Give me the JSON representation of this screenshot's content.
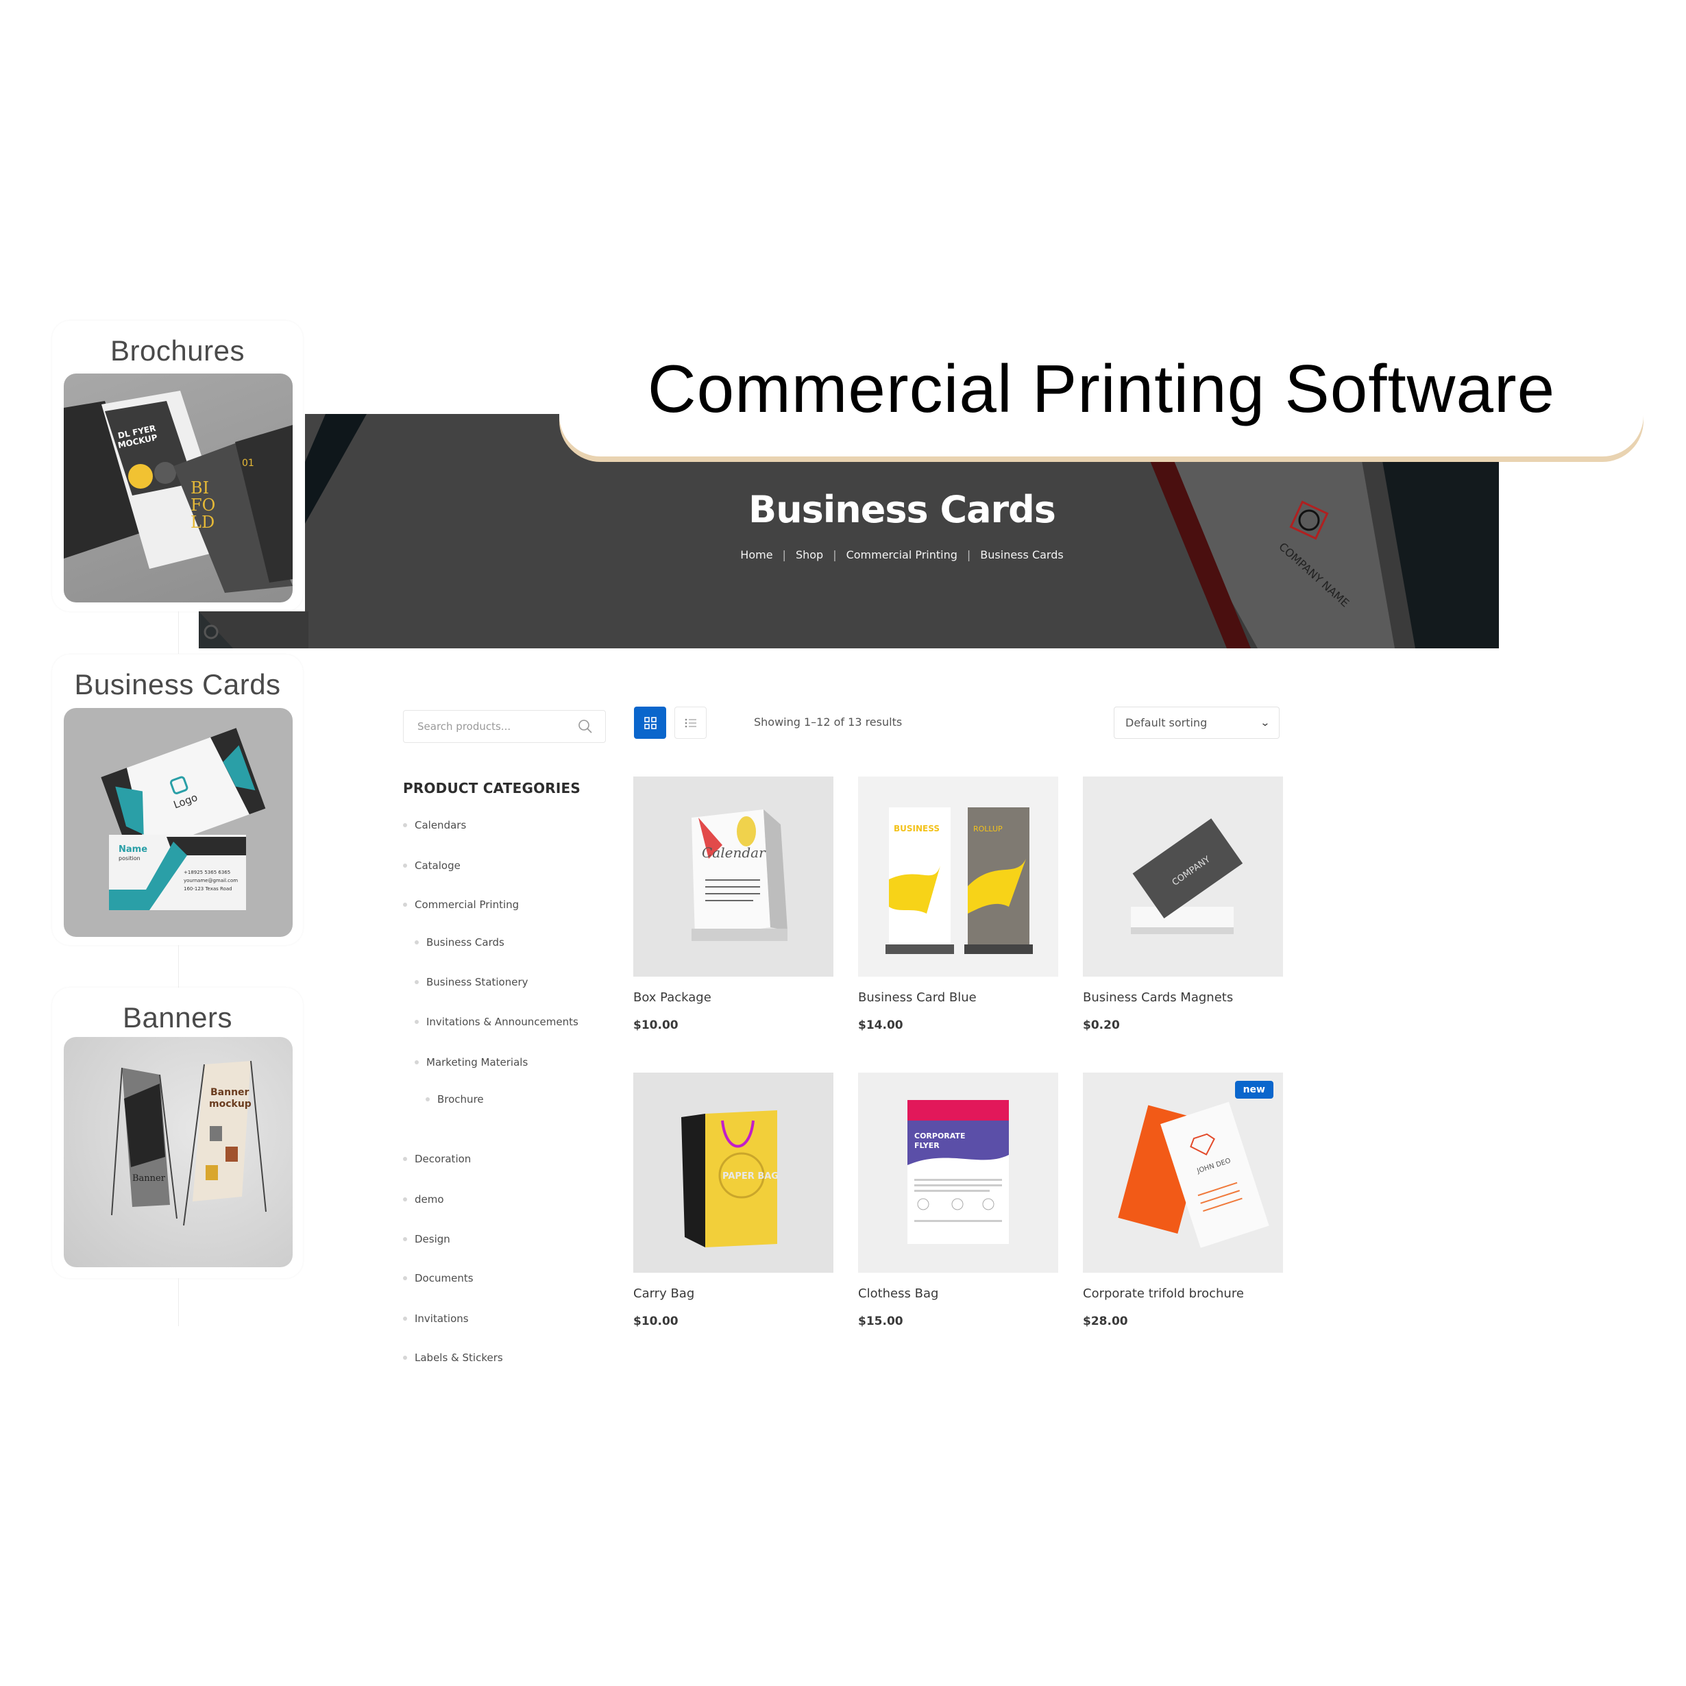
{
  "headline": "Commercial Printing Software",
  "showcase": [
    {
      "label": "Brochures"
    },
    {
      "label": "Business Cards"
    },
    {
      "label": "Banners"
    }
  ],
  "hero": {
    "title": "Business Cards",
    "breadcrumb": [
      "Home",
      "Shop",
      "Commercial Printing",
      "Business Cards"
    ]
  },
  "toolbar": {
    "search_placeholder": "Search products...",
    "result_count": "Showing 1–12 of 13 results",
    "sort_selected": "Default sorting",
    "view_mode": "grid"
  },
  "sidebar": {
    "heading": "PRODUCT CATEGORIES",
    "categories": [
      {
        "label": "Calendars",
        "level": 0
      },
      {
        "label": "Cataloge",
        "level": 0
      },
      {
        "label": "Commercial Printing",
        "level": 0
      },
      {
        "label": "Business Cards",
        "level": 1
      },
      {
        "label": "Business Stationery",
        "level": 1
      },
      {
        "label": "Invitations & Announcements",
        "level": 1
      },
      {
        "label": "Marketing Materials",
        "level": 1
      },
      {
        "label": "Brochure",
        "level": 2
      },
      {
        "label": "Decoration",
        "level": 0
      },
      {
        "label": "demo",
        "level": 0
      },
      {
        "label": "Design",
        "level": 0
      },
      {
        "label": "Documents",
        "level": 0
      },
      {
        "label": "Invitations",
        "level": 0
      },
      {
        "label": "Labels & Stickers",
        "level": 0
      }
    ]
  },
  "products": [
    {
      "name": "Box Package",
      "price": "$10.00",
      "image": "desk-calendar"
    },
    {
      "name": "Business Card Blue",
      "price": "$14.00",
      "image": "rollup-banners"
    },
    {
      "name": "Business Cards Magnets",
      "price": "$0.20",
      "image": "company-card-stack"
    },
    {
      "name": "Carry Bag",
      "price": "$10.00",
      "image": "yellow-paper-bag"
    },
    {
      "name": "Clothess Bag",
      "price": "$15.00",
      "image": "corporate-flyer"
    },
    {
      "name": "Corporate trifold brochure",
      "price": "$28.00",
      "image": "orange-business-cards",
      "badge": "new"
    }
  ],
  "colors": {
    "accent": "#0a66cc",
    "hero_bg": "#434343",
    "pill_shadow": "#e9d3b1"
  }
}
